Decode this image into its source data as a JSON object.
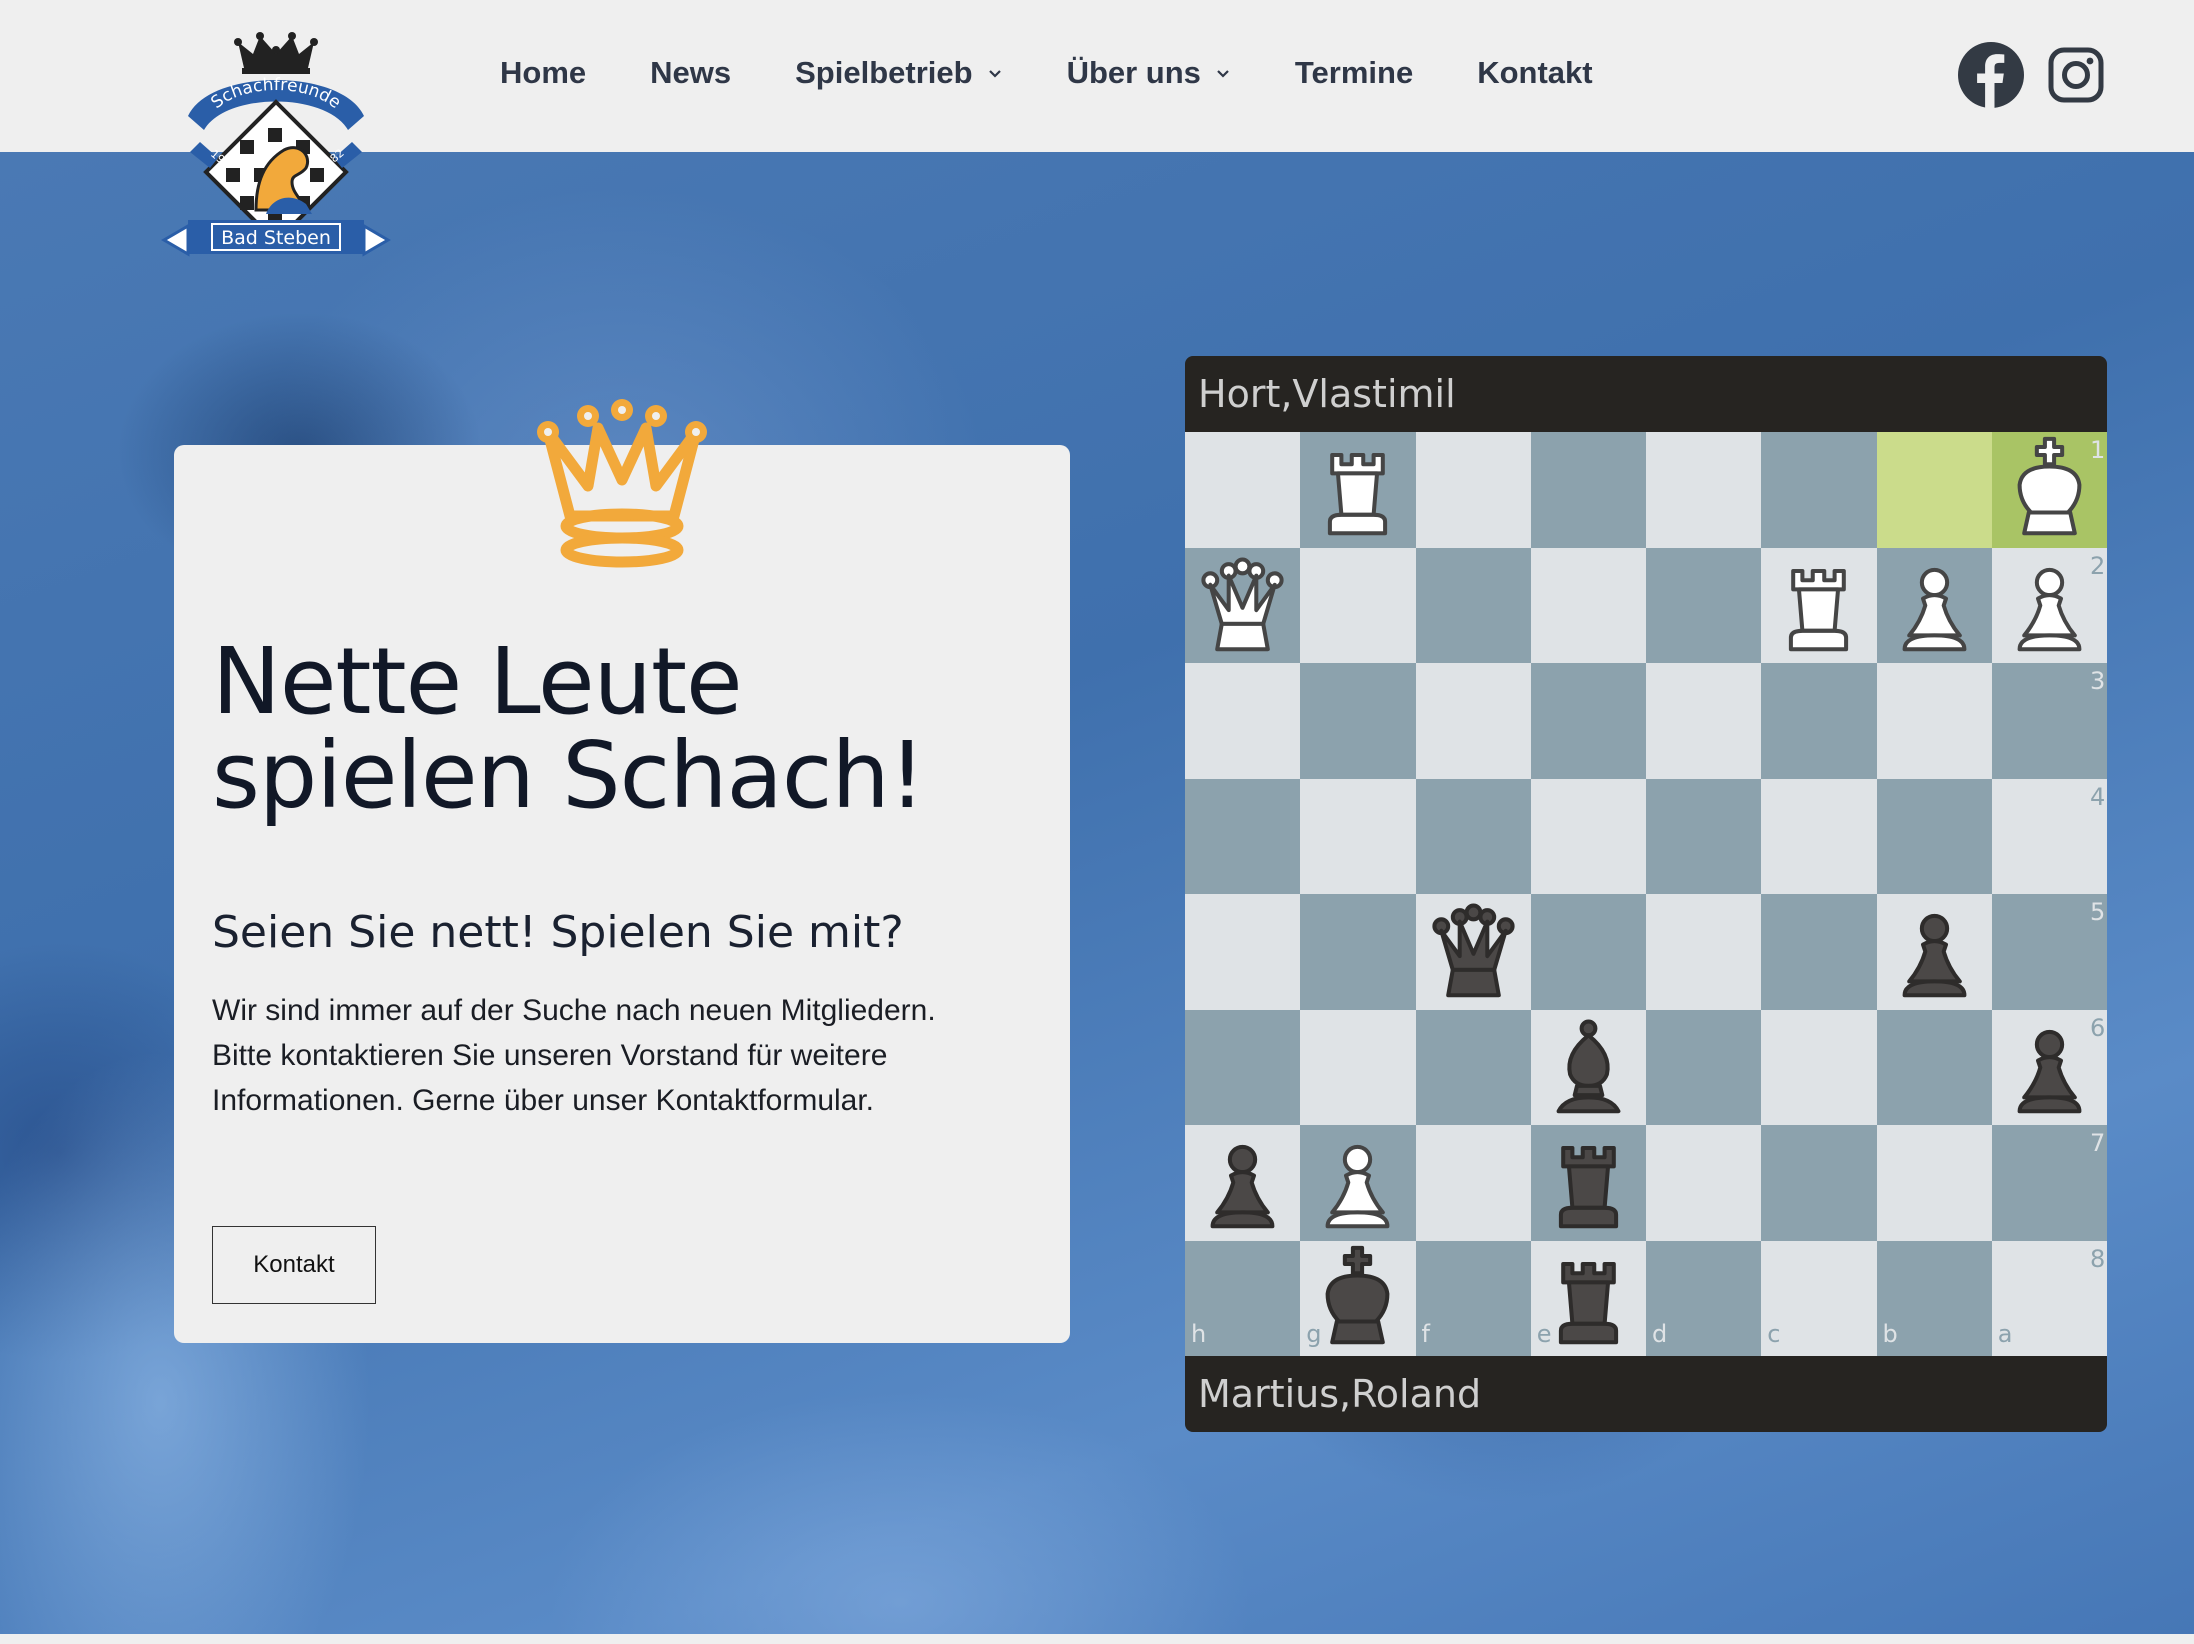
{
  "header": {
    "logo": {
      "top_text": "Schachfreunde",
      "year_left": "19",
      "year_right": "82",
      "banner_text": "Bad Steben"
    },
    "nav": [
      {
        "label": "Home",
        "dropdown": false
      },
      {
        "label": "News",
        "dropdown": false
      },
      {
        "label": "Spielbetrieb",
        "dropdown": true
      },
      {
        "label": "Über uns",
        "dropdown": true
      },
      {
        "label": "Termine",
        "dropdown": false
      },
      {
        "label": "Kontakt",
        "dropdown": false
      }
    ],
    "social": [
      "facebook-icon",
      "instagram-icon"
    ]
  },
  "hero": {
    "title_line1": "Nette Leute",
    "title_line2": "spielen Schach!",
    "subtitle": "Seien Sie nett! Spielen Sie mit?",
    "text_line1": "Wir sind immer auf der Suche nach neuen Mitgliedern.",
    "text_line2": "Bitte kontaktieren Sie unseren Vorstand für weitere",
    "text_line3": "Informationen. Gerne über unser Kontaktformular.",
    "button_label": "Kontakt",
    "crown_color": "#f2a93b"
  },
  "chess": {
    "top_player": "Hort,Vlastimil",
    "bottom_player": "Martius,Roland",
    "orientation": "black",
    "last_move_squares": [
      "b1",
      "a1"
    ],
    "pieces": [
      {
        "square": "g1",
        "type": "rook",
        "color": "white"
      },
      {
        "square": "a1",
        "type": "king",
        "color": "white"
      },
      {
        "square": "h2",
        "type": "queen",
        "color": "white"
      },
      {
        "square": "c2",
        "type": "rook",
        "color": "white"
      },
      {
        "square": "b2",
        "type": "pawn",
        "color": "white"
      },
      {
        "square": "a2",
        "type": "pawn",
        "color": "white"
      },
      {
        "square": "f5",
        "type": "queen",
        "color": "black"
      },
      {
        "square": "b5",
        "type": "pawn",
        "color": "black"
      },
      {
        "square": "e6",
        "type": "bishop",
        "color": "black"
      },
      {
        "square": "a6",
        "type": "pawn",
        "color": "black"
      },
      {
        "square": "h7",
        "type": "pawn",
        "color": "black"
      },
      {
        "square": "g7",
        "type": "pawn",
        "color": "white"
      },
      {
        "square": "e7",
        "type": "rook",
        "color": "black"
      },
      {
        "square": "g8",
        "type": "king",
        "color": "black"
      },
      {
        "square": "e8",
        "type": "rook",
        "color": "black"
      }
    ],
    "files": [
      "h",
      "g",
      "f",
      "e",
      "d",
      "c",
      "b",
      "a"
    ],
    "ranks": [
      "1",
      "2",
      "3",
      "4",
      "5",
      "6",
      "7",
      "8"
    ],
    "light_color": "#dfe3e6",
    "dark_color": "#8ca2ad",
    "highlight_color": "#a9c465"
  }
}
